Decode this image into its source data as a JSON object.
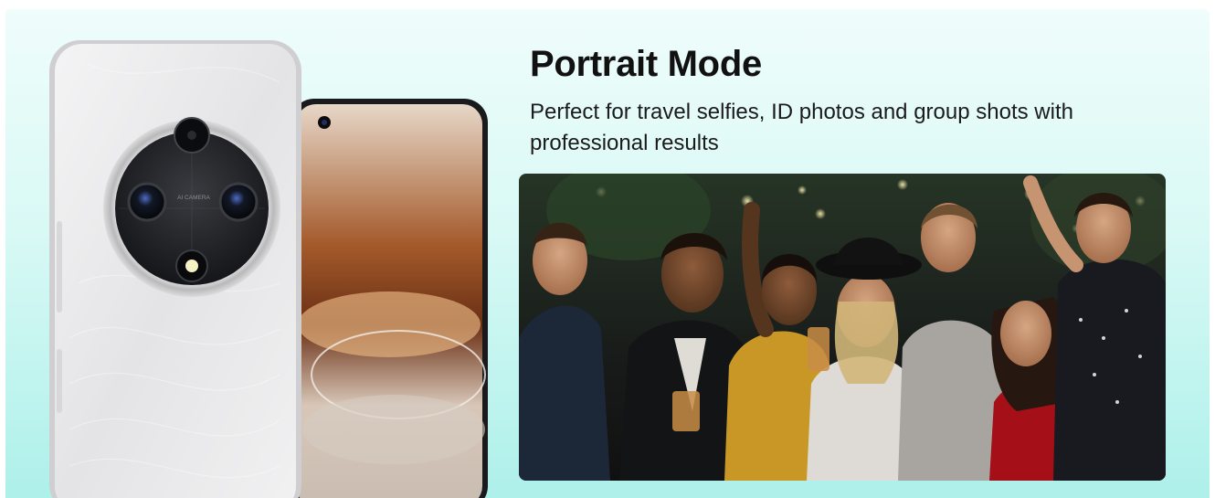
{
  "feature": {
    "title": "Portrait Mode",
    "description": "Perfect for travel selfies, ID photos and group shots with professional results"
  },
  "phone": {
    "camera_ring_text": "AI CAMERA",
    "body_color": "#e9e9ea",
    "module_color": "#1c1d20",
    "accent_color": "#c8854f"
  },
  "photo": {
    "scene": "party-group-photo"
  },
  "colors": {
    "background_top": "#effdfb",
    "background_bottom": "#aef0ea",
    "title": "#111111"
  }
}
